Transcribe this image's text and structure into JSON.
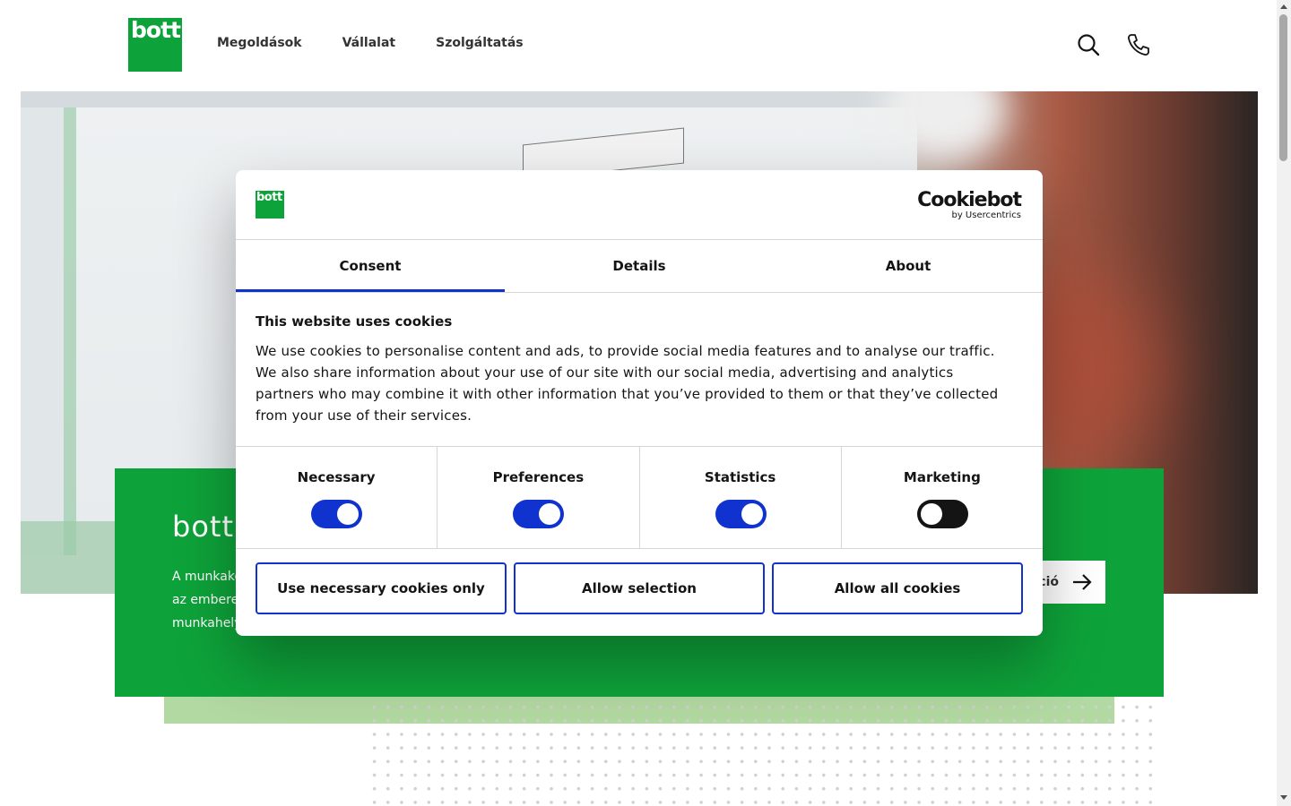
{
  "header": {
    "logo_text": "bott",
    "nav": [
      "Megoldások",
      "Vállalat",
      "Szolgáltatás"
    ],
    "icons": [
      "search-icon",
      "phone-icon"
    ]
  },
  "hero": {
    "banner_title": "bott.",
    "banner_text_lines": [
      "A munkakö",
      "az embere",
      "munkahely"
    ],
    "banner_button_label": "ció",
    "banner_button_icon": "arrow-right-icon"
  },
  "dialog": {
    "logo_text": "bott",
    "provider_main": "Cookiebot",
    "provider_sub": "by Usercentrics",
    "tabs": [
      {
        "label": "Consent",
        "active": true
      },
      {
        "label": "Details",
        "active": false
      },
      {
        "label": "About",
        "active": false
      }
    ],
    "heading": "This website uses cookies",
    "body": "We use cookies to personalise content and ads, to provide social media features and to analyse our traffic. We also share information about your use of our site with our social media, advertising and analytics partners who may combine it with other information that you’ve provided to them or that they’ve collected from your use of their services.",
    "categories": [
      {
        "label": "Necessary",
        "enabled": true
      },
      {
        "label": "Preferences",
        "enabled": true
      },
      {
        "label": "Statistics",
        "enabled": true
      },
      {
        "label": "Marketing",
        "enabled": false
      }
    ],
    "buttons": {
      "necessary_only": "Use necessary cookies only",
      "allow_selection": "Allow selection",
      "allow_all": "Allow all cookies"
    }
  },
  "colors": {
    "brand_green": "#0ea33a",
    "accent_blue": "#1032cf",
    "light_green": "#b3d9a2"
  }
}
